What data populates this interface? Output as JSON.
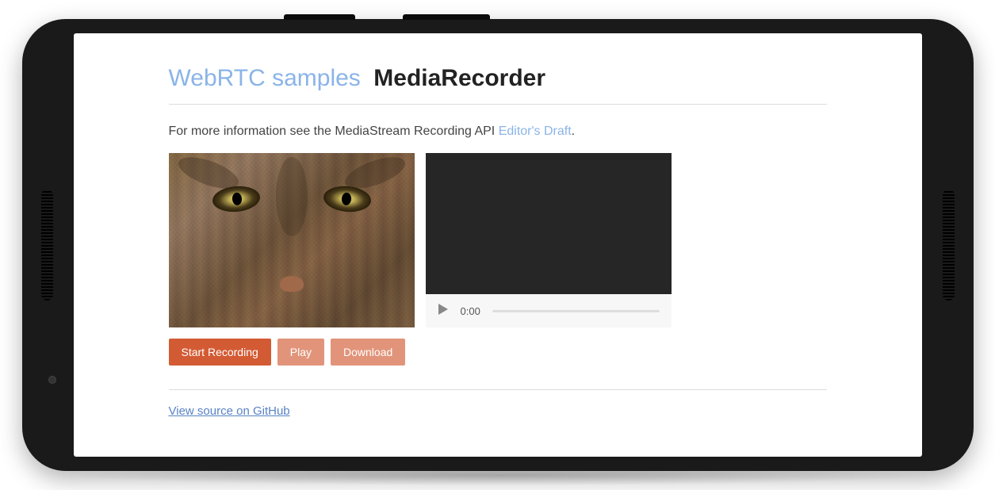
{
  "header": {
    "link_text": "WebRTC samples",
    "page_title": "MediaRecorder"
  },
  "info": {
    "prefix": "For more information see the MediaStream Recording API ",
    "link_text": "Editor's Draft",
    "suffix": "."
  },
  "player": {
    "time": "0:00"
  },
  "buttons": {
    "start_recording": "Start Recording",
    "play": "Play",
    "download": "Download"
  },
  "footer": {
    "github_link": "View source on GitHub"
  },
  "colors": {
    "accent": "#d35b34",
    "link_light": "#8ab4e8",
    "link_blue": "#5882c4"
  }
}
